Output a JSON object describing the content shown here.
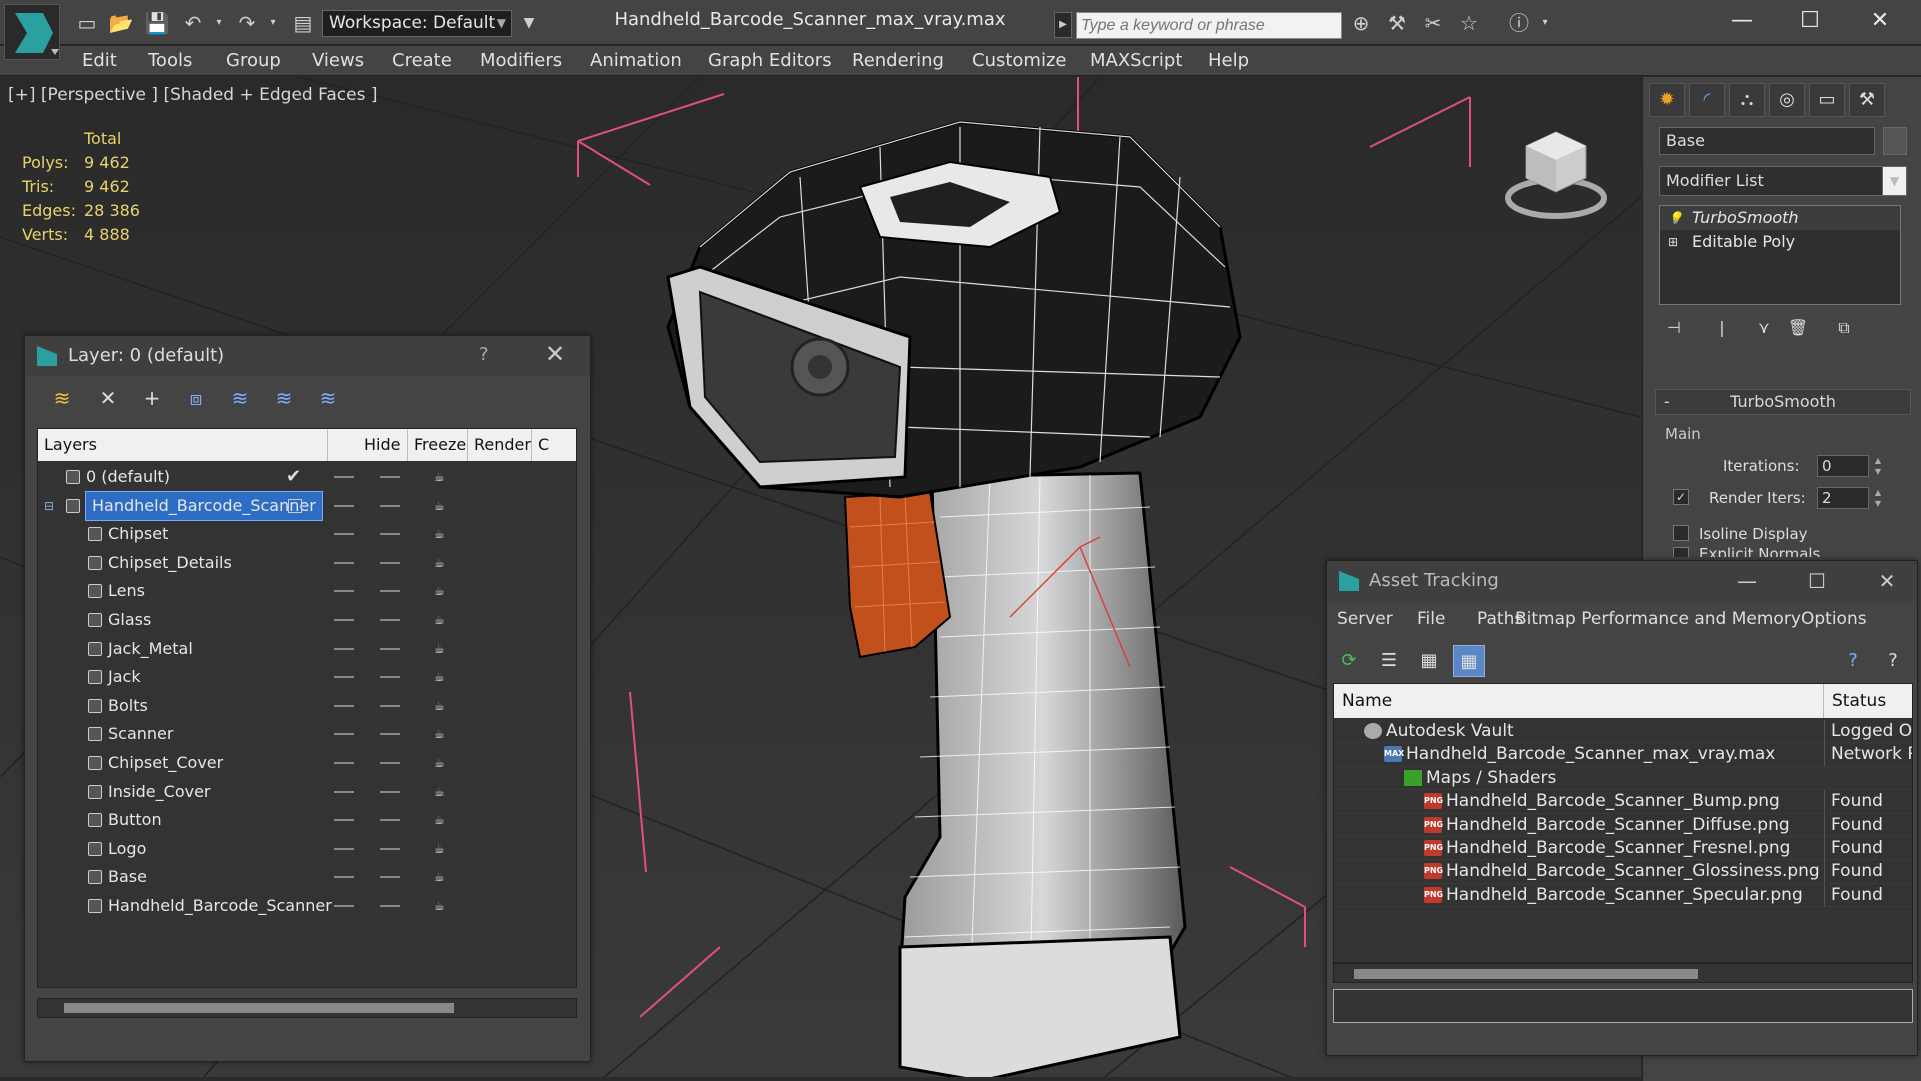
{
  "titlebar": {
    "workspace_label": "Workspace: Default",
    "document_title": "Handheld_Barcode_Scanner_max_vray.max",
    "search_placeholder": "Type a keyword or phrase"
  },
  "menu": [
    "Edit",
    "Tools",
    "Group",
    "Views",
    "Create",
    "Modifiers",
    "Animation",
    "Graph Editors",
    "Rendering",
    "Customize",
    "MAXScript",
    "Help"
  ],
  "viewport": {
    "label": "[+] [Perspective ] [Shaded + Edged Faces ]",
    "stats": {
      "header": "Total",
      "rows": [
        {
          "key": "Polys:",
          "value": "9 462"
        },
        {
          "key": "Tris:",
          "value": "9 462"
        },
        {
          "key": "Edges:",
          "value": "28 386"
        },
        {
          "key": "Verts:",
          "value": "4 888"
        }
      ]
    }
  },
  "command_panel": {
    "object_name": "Base",
    "modifier_list": "Modifier List",
    "stack": [
      "TurboSmooth",
      "Editable Poly"
    ],
    "rollout_title": "TurboSmooth",
    "group_main": "Main",
    "iterations_label": "Iterations:",
    "iterations_value": "0",
    "render_iters_label": "Render Iters:",
    "render_iters_value": "2",
    "isoline_label": "Isoline Display",
    "explicit_label": "Explicit Normals"
  },
  "layer_panel": {
    "title": "Layer: 0 (default)",
    "help": "?",
    "columns": [
      "Layers",
      "Hide",
      "Freeze",
      "Render",
      "C"
    ],
    "rows": [
      {
        "name": "0 (default)",
        "level": 0
      },
      {
        "name": "Handheld_Barcode_Scanner",
        "level": 0
      },
      {
        "name": "Chipset",
        "level": 1
      },
      {
        "name": "Chipset_Details",
        "level": 1
      },
      {
        "name": "Lens",
        "level": 1
      },
      {
        "name": "Glass",
        "level": 1
      },
      {
        "name": "Jack_Metal",
        "level": 1
      },
      {
        "name": "Jack",
        "level": 1
      },
      {
        "name": "Bolts",
        "level": 1
      },
      {
        "name": "Scanner",
        "level": 1
      },
      {
        "name": "Chipset_Cover",
        "level": 1
      },
      {
        "name": "Inside_Cover",
        "level": 1
      },
      {
        "name": "Button",
        "level": 1
      },
      {
        "name": "Logo",
        "level": 1
      },
      {
        "name": "Base",
        "level": 1
      },
      {
        "name": "Handheld_Barcode_Scanner",
        "level": 1
      }
    ]
  },
  "asset_tracking": {
    "title": "Asset Tracking",
    "menu": [
      "Server",
      "File",
      "Paths",
      "Bitmap Performance and Memory",
      "Options"
    ],
    "columns": [
      "Name",
      "Status"
    ],
    "rows": [
      {
        "name": "Autodesk Vault",
        "status": "Logged Out",
        "icon": "vault"
      },
      {
        "name": "Handheld_Barcode_Scanner_max_vray.max",
        "status": "Network Path",
        "icon": "max"
      },
      {
        "name": "Maps / Shaders",
        "status": "",
        "icon": "folder"
      },
      {
        "name": "Handheld_Barcode_Scanner_Bump.png",
        "status": "Found",
        "icon": "png"
      },
      {
        "name": "Handheld_Barcode_Scanner_Diffuse.png",
        "status": "Found",
        "icon": "png"
      },
      {
        "name": "Handheld_Barcode_Scanner_Fresnel.png",
        "status": "Found",
        "icon": "png"
      },
      {
        "name": "Handheld_Barcode_Scanner_Glossiness.png",
        "status": "Found",
        "icon": "png"
      },
      {
        "name": "Handheld_Barcode_Scanner_Specular.png",
        "status": "Found",
        "icon": "png"
      }
    ],
    "icon_text": {
      "png": "PNG",
      "max": "MAX"
    }
  },
  "colors": {
    "stats_text": "#e8d36a",
    "selection": "#2d6ec4",
    "bounding_box": "#e0507a",
    "trigger_orange": "#c2501c"
  }
}
